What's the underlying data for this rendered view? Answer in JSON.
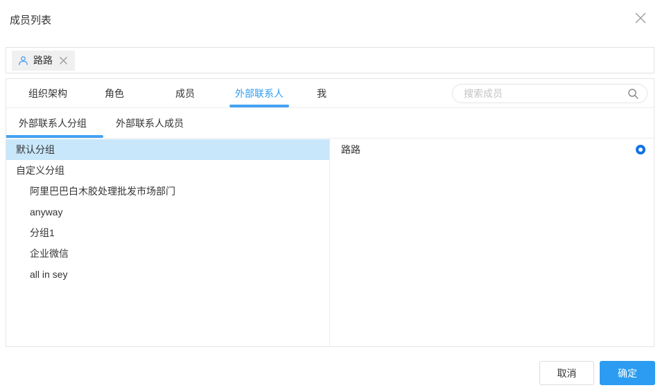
{
  "dialog": {
    "title": "成员列表"
  },
  "selected_tags": [
    {
      "label": "路路"
    }
  ],
  "tabs": [
    {
      "label": "组织架构",
      "active": false
    },
    {
      "label": "角色",
      "active": false
    },
    {
      "label": "成员",
      "active": false
    },
    {
      "label": "外部联系人",
      "active": true
    },
    {
      "label": "我",
      "active": false
    }
  ],
  "search": {
    "placeholder": "搜索成员"
  },
  "sub_tabs": [
    {
      "label": "外部联系人分组",
      "active": true
    },
    {
      "label": "外部联系人成员",
      "active": false
    }
  ],
  "groups": [
    {
      "label": "默认分组",
      "selected": true,
      "indent": 0
    },
    {
      "label": "自定义分组",
      "selected": false,
      "indent": 0
    },
    {
      "label": "阿里巴巴白木胶处理批发市场部门",
      "selected": false,
      "indent": 1
    },
    {
      "label": "anyway",
      "selected": false,
      "indent": 1
    },
    {
      "label": "分组1",
      "selected": false,
      "indent": 1
    },
    {
      "label": "企业微信",
      "selected": false,
      "indent": 1
    },
    {
      "label": "all in sey",
      "selected": false,
      "indent": 1
    }
  ],
  "members": [
    {
      "name": "路路",
      "selected": true
    }
  ],
  "footer": {
    "cancel": "取消",
    "confirm": "确定"
  },
  "icons": {
    "close": "close-icon",
    "person": "person-icon",
    "tag_remove": "remove-tag-icon",
    "search": "search-icon",
    "radio_selected": "radio-selected-icon"
  },
  "colors": {
    "accent_blue": "#2b9cf2",
    "underline_blue": "#44a2f2",
    "selected_row_bg": "#c9e7fb",
    "radio_blue": "#1273e4",
    "tag_bg": "#f0f0f0",
    "border": "#e5e5e5"
  }
}
